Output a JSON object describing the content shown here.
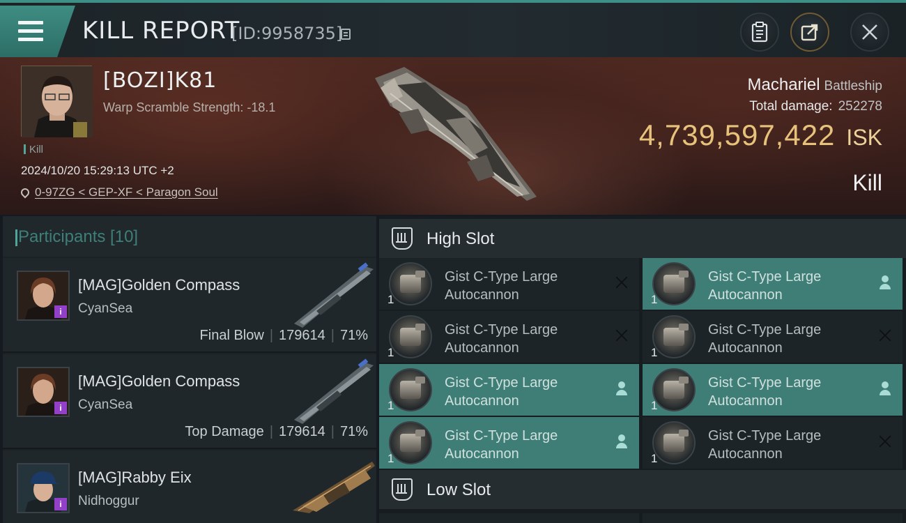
{
  "window": {
    "title": "KILL REPORT",
    "report_id": "[ID:9958735]",
    "icons": [
      "menu-icon",
      "copy-icon",
      "clipboard-icon",
      "share-icon",
      "close-icon"
    ]
  },
  "victim": {
    "name": "[BOZI]K81",
    "scramble": "Warp Scramble Strength: -18.1",
    "tag": "Kill",
    "timestamp": "2024/10/20 15:29:13 UTC +2",
    "location": "0-97ZG < GEP-XF < Paragon Soul",
    "ship": "Machariel",
    "ship_class": "Battleship",
    "total_damage_label": "Total damage:",
    "total_damage": "252278",
    "isk_value": "4,739,597,422",
    "isk_unit": "ISK",
    "result": "Kill"
  },
  "participants": {
    "header": "Participants [10]",
    "items": [
      {
        "name": "[MAG]Golden Compass",
        "ship": "CyanSea",
        "badge": "i",
        "role": "Final Blow",
        "damage": "179614",
        "percent": "71%"
      },
      {
        "name": "[MAG]Golden Compass",
        "ship": "CyanSea",
        "badge": "i",
        "role": "Top Damage",
        "damage": "179614",
        "percent": "71%"
      },
      {
        "name": "[MAG]Rabby Eix",
        "ship": "Nidhoggur",
        "badge": "i"
      }
    ]
  },
  "slots": {
    "high_label": "High Slot",
    "low_label": "Low Slot",
    "high_modules": [
      {
        "name_line1": "Gist C-Type Large",
        "name_line2": "Autocannon",
        "qty": "1",
        "status": "destroyed"
      },
      {
        "name_line1": "Gist C-Type Large",
        "name_line2": "Autocannon",
        "qty": "1",
        "status": "dropped"
      },
      {
        "name_line1": "Gist C-Type Large",
        "name_line2": "Autocannon",
        "qty": "1",
        "status": "destroyed"
      },
      {
        "name_line1": "Gist C-Type Large",
        "name_line2": "Autocannon",
        "qty": "1",
        "status": "destroyed"
      },
      {
        "name_line1": "Gist C-Type Large",
        "name_line2": "Autocannon",
        "qty": "1",
        "status": "dropped"
      },
      {
        "name_line1": "Gist C-Type Large",
        "name_line2": "Autocannon",
        "qty": "1",
        "status": "dropped"
      },
      {
        "name_line1": "Gist C-Type Large",
        "name_line2": "Autocannon",
        "qty": "1",
        "status": "dropped"
      },
      {
        "name_line1": "Gist C-Type Large",
        "name_line2": "Autocannon",
        "qty": "1",
        "status": "destroyed"
      }
    ]
  },
  "colors": {
    "accent_teal": "#3f7e77",
    "isk_gold": "#e7c27b",
    "badge_purple": "#9340c9"
  }
}
